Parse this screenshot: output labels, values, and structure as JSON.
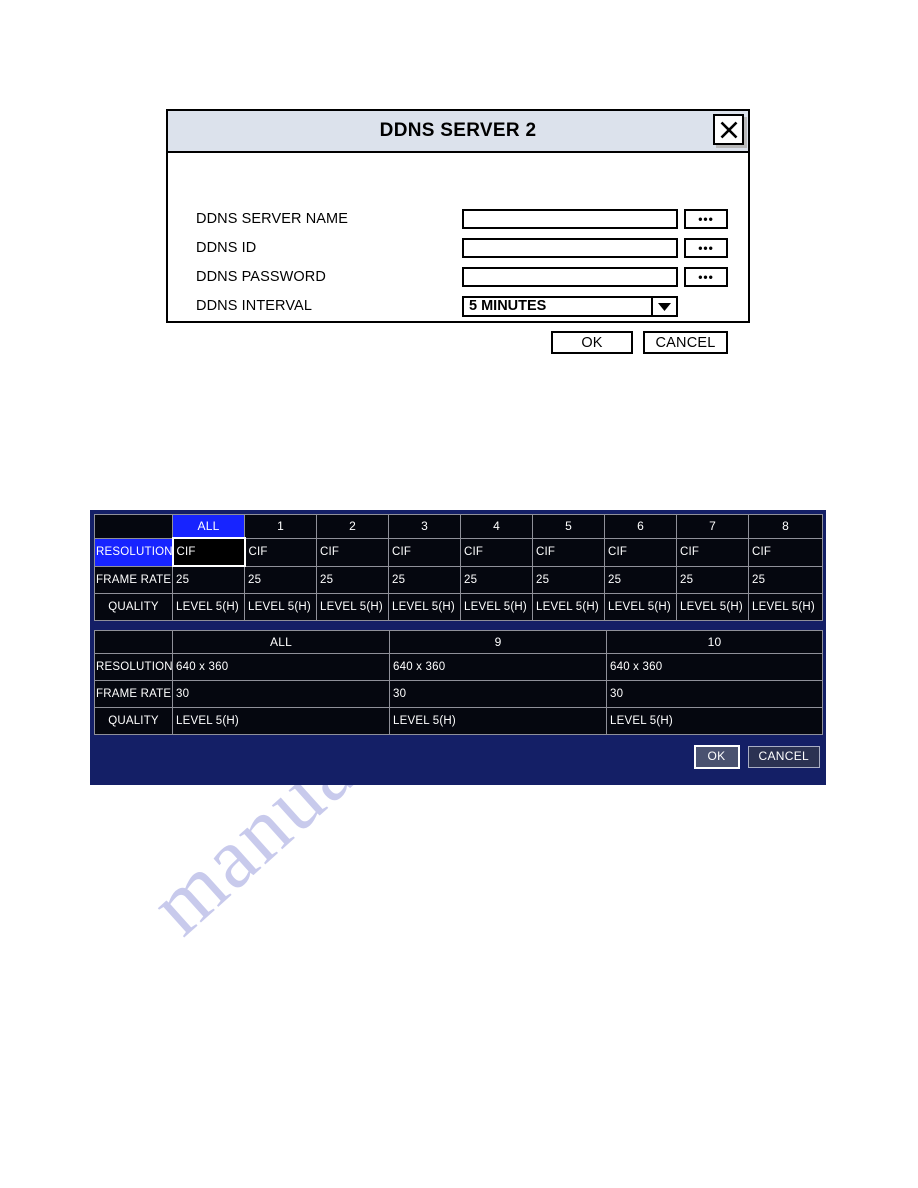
{
  "watermark": {
    "text": "manualzilla.com"
  },
  "dialog": {
    "title": "DDNS SERVER 2",
    "close_icon": "close-x-icon",
    "fields": [
      {
        "label": "DDNS SERVER NAME",
        "value": "",
        "placeholder": "",
        "browse_label": "•••"
      },
      {
        "label": "DDNS ID",
        "value": "",
        "placeholder": "",
        "browse_label": "•••"
      },
      {
        "label": "DDNS PASSWORD",
        "value": "",
        "placeholder": "",
        "browse_label": "•••"
      }
    ],
    "interval": {
      "label": "DDNS INTERVAL",
      "value": "5 MINUTES",
      "arrow_icon": "chevron-down-icon"
    },
    "ok_label": "OK",
    "cancel_label": "CANCEL"
  },
  "dvr": {
    "panel_color": "#141f66",
    "highlight_color": "#1724ff",
    "table1": {
      "headers": [
        "",
        "ALL",
        "1",
        "2",
        "3",
        "4",
        "5",
        "6",
        "7",
        "8"
      ],
      "selected_header_index": 1,
      "row_labels": [
        "RESOLUTION",
        "FRAME RATE",
        "QUALITY"
      ],
      "selected_row_label_index": 0,
      "selected_cell": {
        "row": 0,
        "col": 0
      },
      "rows": [
        [
          "CIF",
          "CIF",
          "CIF",
          "CIF",
          "CIF",
          "CIF",
          "CIF",
          "CIF",
          "CIF"
        ],
        [
          "25",
          "25",
          "25",
          "25",
          "25",
          "25",
          "25",
          "25",
          "25"
        ],
        [
          "LEVEL 5(H)",
          "LEVEL 5(H)",
          "LEVEL 5(H)",
          "LEVEL 5(H)",
          "LEVEL 5(H)",
          "LEVEL 5(H)",
          "LEVEL 5(H)",
          "LEVEL 5(H)",
          "LEVEL 5(H)"
        ]
      ]
    },
    "table2": {
      "headers": [
        "",
        "ALL",
        "9",
        "10"
      ],
      "row_labels": [
        "RESOLUTION",
        "FRAME RATE",
        "QUALITY"
      ],
      "rows": [
        [
          "640 x 360",
          "640 x 360",
          "640 x 360"
        ],
        [
          "30",
          "30",
          "30"
        ],
        [
          "LEVEL 5(H)",
          "LEVEL 5(H)",
          "LEVEL 5(H)"
        ]
      ]
    },
    "ok_label": "OK",
    "cancel_label": "CANCEL"
  }
}
